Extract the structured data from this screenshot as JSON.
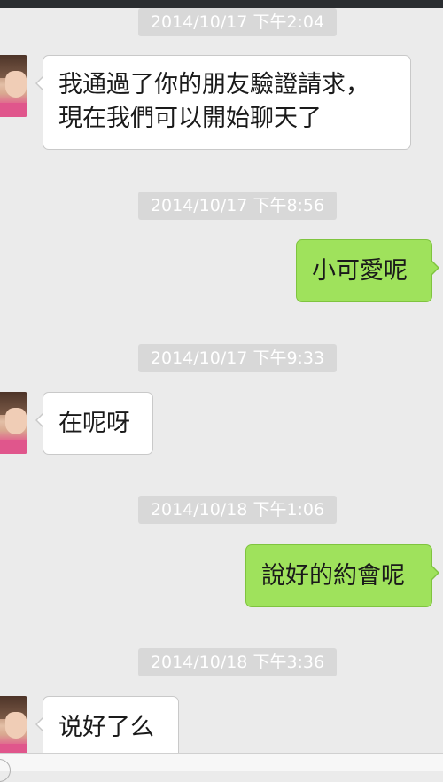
{
  "messages": [
    {
      "timestamp": "2014/10/17 下午2:04",
      "sender": "contact",
      "lines": [
        "我通過了你的朋友驗證請求，",
        "現在我們可以開始聊天了"
      ]
    },
    {
      "timestamp": "2014/10/17 下午8:56",
      "sender": "me",
      "lines": [
        "小可愛呢"
      ]
    },
    {
      "timestamp": "2014/10/17 下午9:33",
      "sender": "contact",
      "lines": [
        "在呢呀"
      ]
    },
    {
      "timestamp": "2014/10/18 下午1:06",
      "sender": "me",
      "lines": [
        "說好的約會呢"
      ]
    },
    {
      "timestamp": "2014/10/18 下午3:36",
      "sender": "contact",
      "lines": [
        "说好了么"
      ]
    }
  ],
  "colors": {
    "background": "#ebebeb",
    "incoming_bubble": "#ffffff",
    "outgoing_bubble": "#9fe25c",
    "timestamp_pill": "#d8d8d8"
  }
}
